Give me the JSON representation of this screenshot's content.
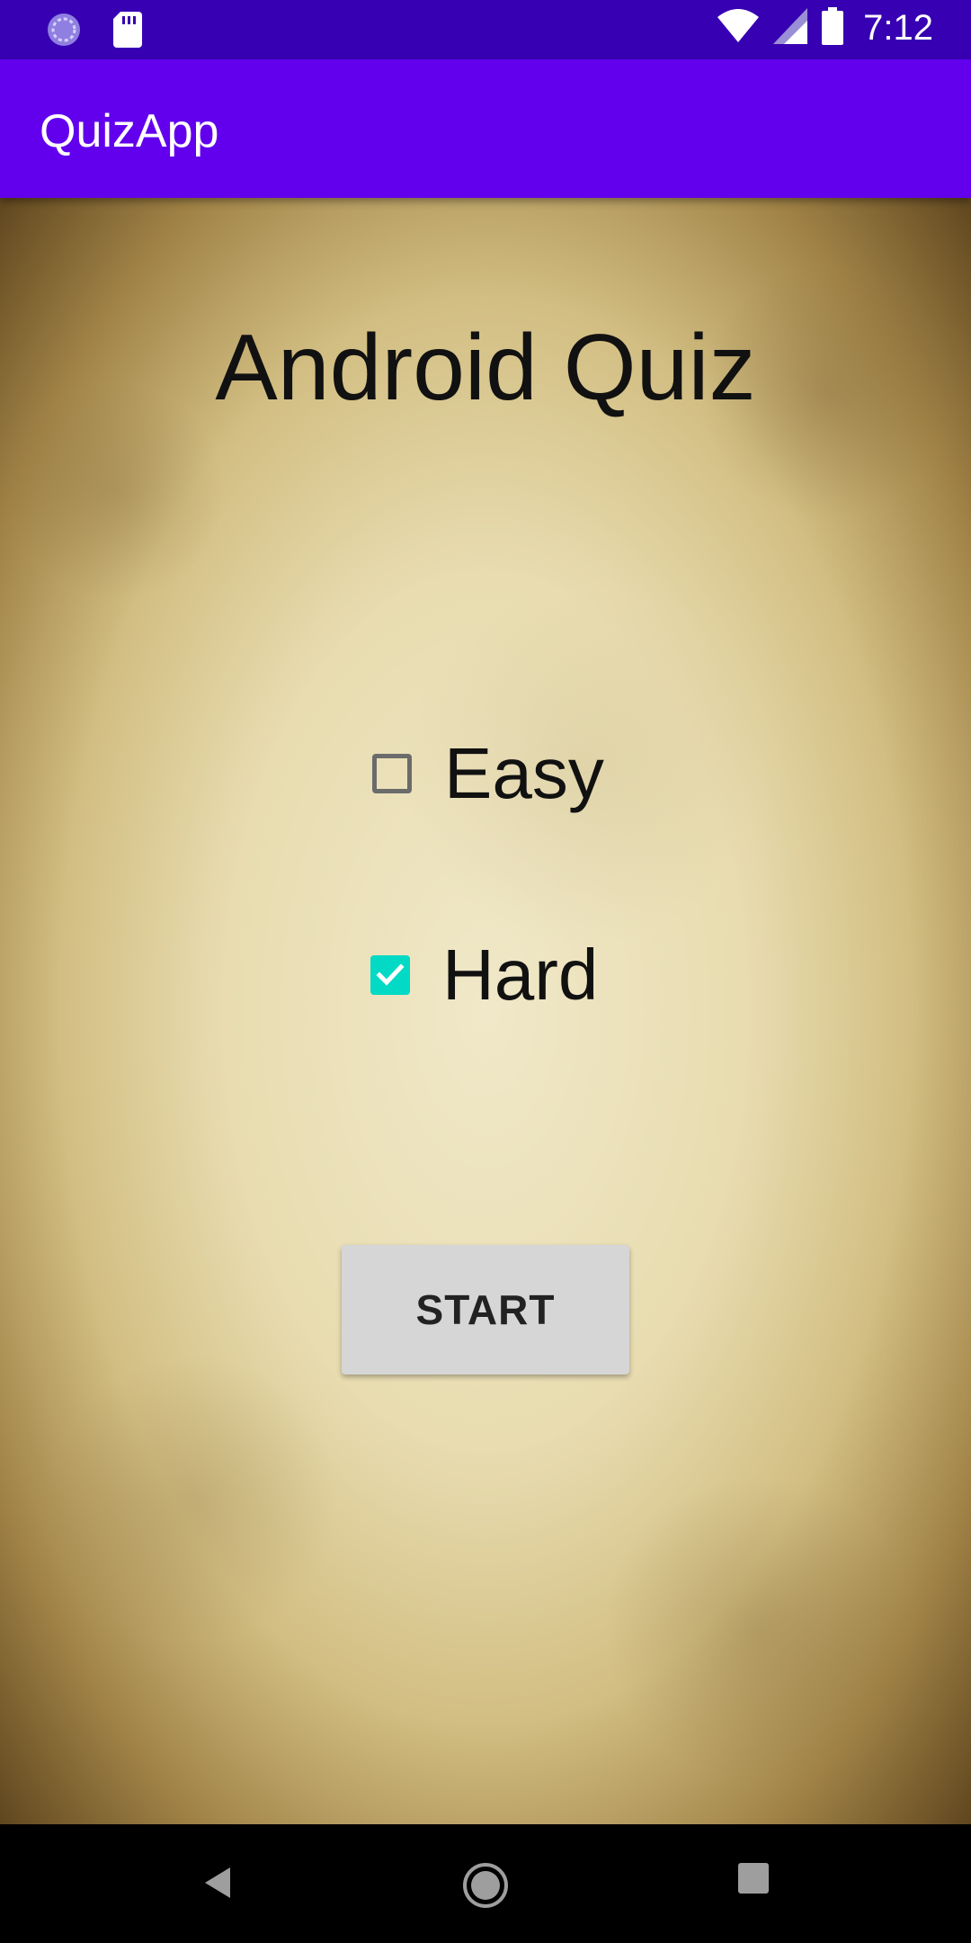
{
  "status_bar": {
    "time": "7:12",
    "icons": [
      "sync-icon",
      "sd-card-icon",
      "wifi-icon",
      "signal-icon",
      "battery-icon"
    ]
  },
  "app_bar": {
    "title": "QuizApp"
  },
  "main": {
    "title": "Android Quiz",
    "options": [
      {
        "label": "Easy",
        "checked": false
      },
      {
        "label": "Hard",
        "checked": true
      }
    ],
    "start_label": "START"
  },
  "colors": {
    "status_bar": "#3700b3",
    "app_bar": "#6200ee",
    "checkbox_checked": "#03dac5",
    "button_bg": "#d6d6d6"
  },
  "nav_bar": {
    "icons": [
      "back-icon",
      "home-icon",
      "recents-icon"
    ]
  }
}
